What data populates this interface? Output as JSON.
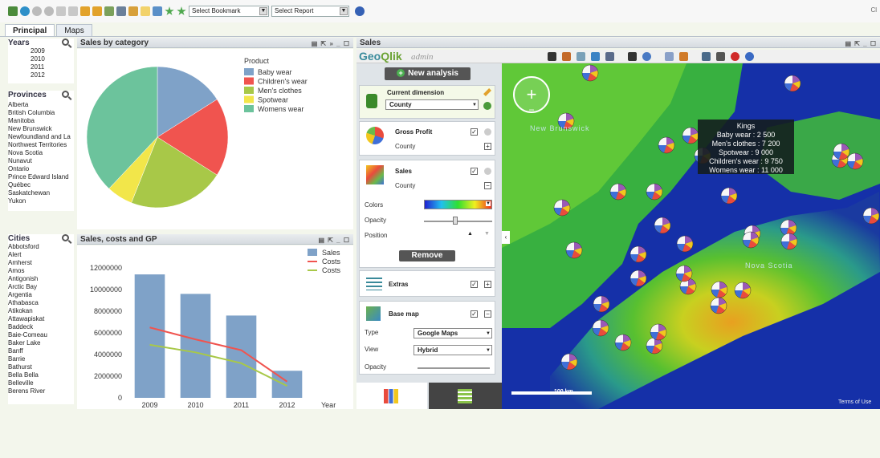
{
  "toolbar": {
    "bookmark_select": "Select Bookmark",
    "report_select": "Select Report",
    "right_text": "Cl"
  },
  "tabs": [
    {
      "label": "Principal",
      "active": true
    },
    {
      "label": "Maps",
      "active": false
    }
  ],
  "years": {
    "title": "Years",
    "items": [
      "2009",
      "2010",
      "2011",
      "2012"
    ]
  },
  "provinces": {
    "title": "Provinces",
    "items": [
      "Alberta",
      "British Columbia",
      "Manitoba",
      "New Brunswick",
      "Newfoundland and La",
      "Northwest Territories",
      "Nova Scotia",
      "Nunavut",
      "Ontario",
      "Prince Edward Island",
      "Québec",
      "Saskatchewan",
      "Yukon"
    ]
  },
  "cities": {
    "title": "Cities",
    "items": [
      "Abbotsford",
      "Alert",
      "Amherst",
      "Amos",
      "Antigonish",
      "Arctic Bay",
      "Argentia",
      "Athabasca",
      "Atikokan",
      "Attawapiskat",
      "Baddeck",
      "Baie-Comeau",
      "Baker Lake",
      "Banff",
      "Barrie",
      "Bathurst",
      "Bella Bella",
      "Belleville",
      "Berens River"
    ]
  },
  "pie_panel": {
    "title": "Sales by category",
    "legend_title": "Product"
  },
  "combo_panel": {
    "title": "Sales, costs and GP",
    "xlabel": "Year"
  },
  "sales_panel": {
    "title": "Sales"
  },
  "geoqlik": {
    "logo_geo": "Geo",
    "logo_qlik": "Qlik",
    "admin": "admin",
    "new_analysis": "New analysis",
    "current_dimension_title": "Current dimension",
    "dimension_value": "County",
    "gross_profit_title": "Gross Profit",
    "gross_profit_sub": "County",
    "sales_title": "Sales",
    "sales_sub": "County",
    "colors_label": "Colors",
    "opacity_label": "Opacity",
    "position_label": "Position",
    "remove_button": "Remove",
    "extras_title": "Extras",
    "base_map_title": "Base map",
    "type_label": "Type",
    "type_value": "Google Maps",
    "view_label": "View",
    "view_value": "Hybrid",
    "opacity2_label": "Opacity"
  },
  "map": {
    "labels": [
      "New Brunswick",
      "Nova Scotia"
    ],
    "scale_label": "100 km",
    "terms": "Terms of Use",
    "tooltip": {
      "title": "Kings",
      "lines": [
        "Baby wear : 2 500",
        "Men's clothes : 7 200",
        "Spotwear : 9 000",
        "Children's wear : 9 750",
        "Womens wear : 11 000"
      ]
    }
  },
  "chart_data": [
    {
      "type": "pie",
      "title": "Sales by category",
      "legend_title": "Product",
      "categories": [
        "Baby wear",
        "Children's wear",
        "Men's clothes",
        "Spotwear",
        "Womens wear"
      ],
      "values": [
        16,
        18,
        22,
        6,
        38
      ],
      "colors": [
        "#7fa2c8",
        "#f0544f",
        "#a8c848",
        "#f2e64a",
        "#6cc39c"
      ],
      "legend_position": "right"
    },
    {
      "type": "bar",
      "title": "Sales, costs and GP",
      "categories": [
        "2009",
        "2010",
        "2011",
        "2012"
      ],
      "xlabel": "Year",
      "ylim": [
        0,
        12000000
      ],
      "yticks": [
        "0",
        "2000000",
        "4000000",
        "6000000",
        "8000000",
        "10000000",
        "12000000"
      ],
      "series": [
        {
          "name": "Sales",
          "type": "bar",
          "color": "#7fa2c8",
          "values": [
            11400000,
            9600000,
            7600000,
            2500000
          ]
        },
        {
          "name": "Costs",
          "type": "line",
          "color": "#f0544f",
          "values": [
            6500000,
            5400000,
            4400000,
            1500000
          ]
        },
        {
          "name": "Costs",
          "type": "line",
          "color": "#a8c848",
          "values": [
            4900000,
            4200000,
            3200000,
            1100000
          ]
        }
      ],
      "legend_position": "top-right"
    }
  ]
}
